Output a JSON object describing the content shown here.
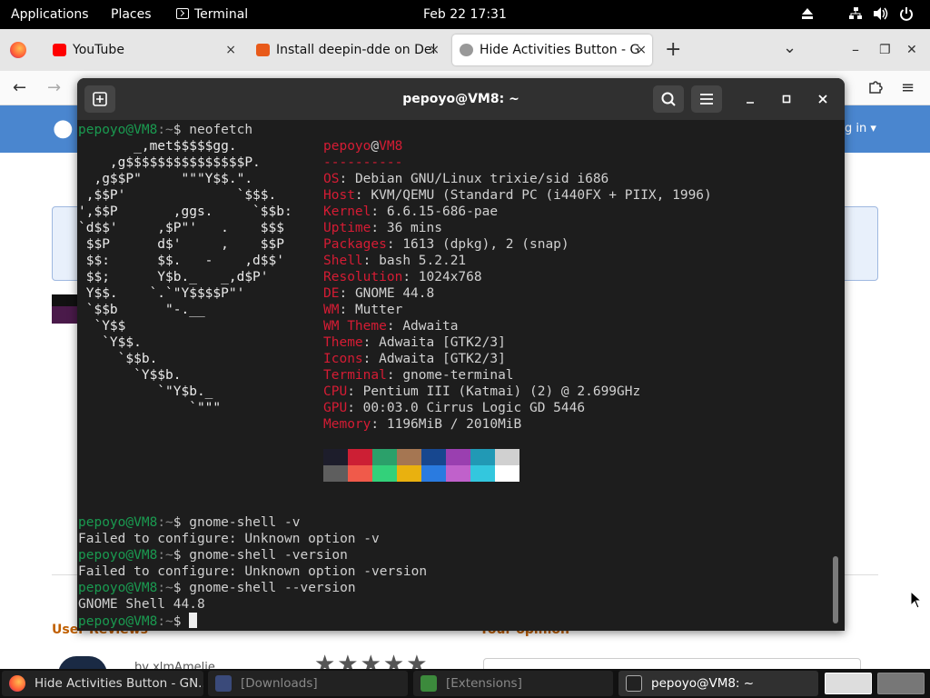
{
  "top_panel": {
    "applications": "Applications",
    "places": "Places",
    "terminal_app": "Terminal",
    "clock": "Feb 22  17:31"
  },
  "firefox": {
    "tabs": [
      {
        "label": "YouTube",
        "close": "×"
      },
      {
        "label": "Install deepin-dde on Del",
        "close": "×"
      },
      {
        "label": "Hide Activities Button - G",
        "close": "×"
      }
    ],
    "new_tab": "+",
    "list_all": "⌄",
    "window_controls": {
      "minimize": "–",
      "restore": "❐",
      "close": "✕"
    },
    "nav": {
      "back": "←",
      "forward": "→",
      "menu": "≡"
    }
  },
  "webpage": {
    "login": "g in ▾",
    "user_reviews": "User Reviews",
    "your_opinion": "Your opinion",
    "byline": "by xlmAmelie",
    "stars": "★★★★★"
  },
  "terminal": {
    "title": "pepoyo@VM8: ~",
    "prompt_user": "pepoyo@VM8",
    "prompt_path": ":~",
    "prompt_sign": "$ ",
    "neofetch_cmd": "neofetch",
    "info_user": "pepoyo",
    "info_at": "@",
    "info_host": "VM8",
    "separator": "----------",
    "info": [
      {
        "key": "OS",
        "value": "Debian GNU/Linux trixie/sid i686"
      },
      {
        "key": "Host",
        "value": "KVM/QEMU (Standard PC (i440FX + PIIX, 1996)"
      },
      {
        "key": "Kernel",
        "value": "6.6.15-686-pae"
      },
      {
        "key": "Uptime",
        "value": "36 mins"
      },
      {
        "key": "Packages",
        "value": "1613 (dpkg), 2 (snap)"
      },
      {
        "key": "Shell",
        "value": "bash 5.2.21"
      },
      {
        "key": "Resolution",
        "value": "1024x768"
      },
      {
        "key": "DE",
        "value": "GNOME 44.8"
      },
      {
        "key": "WM",
        "value": "Mutter"
      },
      {
        "key": "WM Theme",
        "value": "Adwaita"
      },
      {
        "key": "Theme",
        "value": "Adwaita [GTK2/3]"
      },
      {
        "key": "Icons",
        "value": "Adwaita [GTK2/3]"
      },
      {
        "key": "Terminal",
        "value": "gnome-terminal"
      },
      {
        "key": "CPU",
        "value": "Pentium III (Katmai) (2) @ 2.699GHz"
      },
      {
        "key": "GPU",
        "value": "00:03.0 Cirrus Logic GD 5446"
      },
      {
        "key": "Memory",
        "value": "1196MiB / 2010MiB"
      }
    ],
    "ascii_art": [
      "       _,met$$$$$gg.",
      "    ,g$$$$$$$$$$$$$$$P.",
      "  ,g$$P\"     \"\"\"Y$$.\".",
      " ,$$P'              `$$$.",
      "',$$P       ,ggs.     `$$b:",
      "`d$$'     ,$P\"'   .    $$$",
      " $$P      d$'     ,    $$P",
      " $$:      $$.   -    ,d$$'",
      " $$;      Y$b._   _,d$P'",
      " Y$$.    `.`\"Y$$$$P\"'",
      " `$$b      \"-.__",
      "  `Y$$",
      "   `Y$$.",
      "     `$$b.",
      "       `Y$$b.",
      "          `\"Y$b._",
      "              `\"\"\""
    ],
    "palette_top": [
      "#1d1d2b",
      "#cc1f34",
      "#2ba06a",
      "#a57652",
      "#17478f",
      "#9a3fb0",
      "#2199b5",
      "#d0d0d0"
    ],
    "palette_bottom": [
      "#5e5e5e",
      "#f05a4a",
      "#33d17a",
      "#e9b10f",
      "#2a7be0",
      "#c061cb",
      "#33c7de",
      "#ffffff"
    ],
    "commands": [
      {
        "cmd": "gnome-shell -v",
        "output": "Failed to configure: Unknown option -v"
      },
      {
        "cmd": "gnome-shell -version",
        "output": "Failed to configure: Unknown option -version"
      },
      {
        "cmd": "gnome-shell --version",
        "output": "GNOME Shell 44.8"
      }
    ]
  },
  "taskbar": {
    "tasks": [
      {
        "label": "Hide Activities Button - GN...",
        "icon": "firefox-icon"
      },
      {
        "label": "[Downloads]",
        "icon": "folder-icon"
      },
      {
        "label": "[Extensions]",
        "icon": "puzzle-icon"
      },
      {
        "label": "pepoyo@VM8: ~",
        "icon": "terminal-icon"
      }
    ]
  }
}
